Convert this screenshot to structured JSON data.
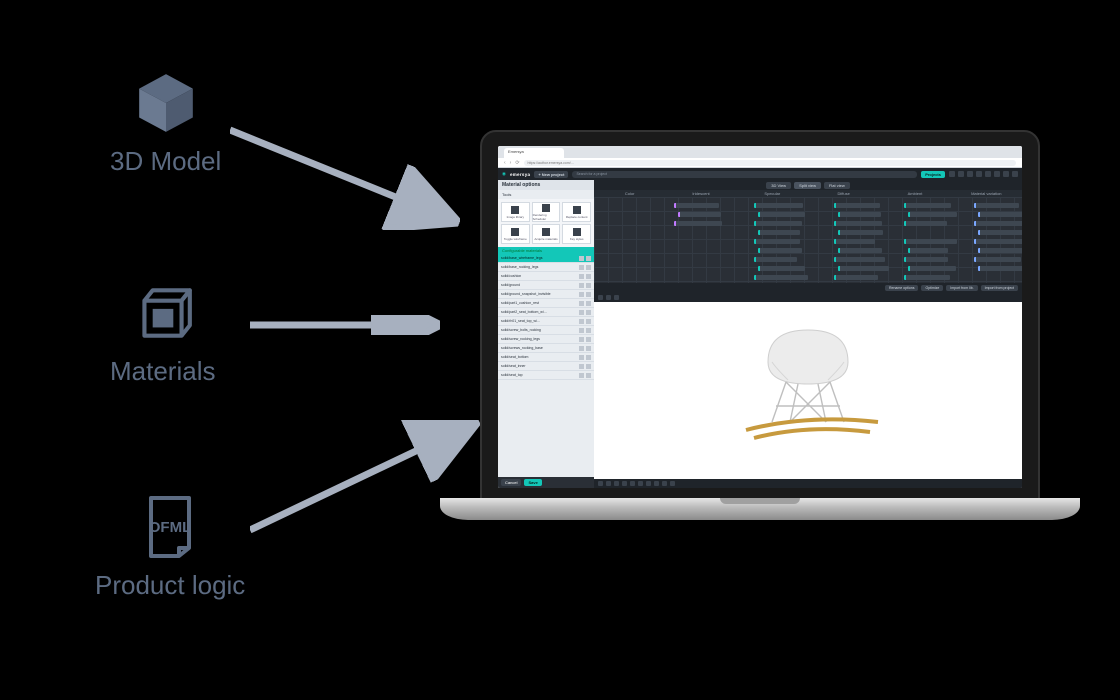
{
  "inputs": {
    "model": {
      "label": "3D Model"
    },
    "materials": {
      "label": "Materials"
    },
    "logic": {
      "label": "Product logic",
      "badge": "OFML"
    }
  },
  "browser": {
    "tab_title": "Emersya",
    "url": "https://author.emersya.com/…"
  },
  "app": {
    "brand": "emersya",
    "new_project": "+ New project",
    "search_placeholder": "Search for a project",
    "projects_btn": "Projects"
  },
  "panel": {
    "title": "Material options",
    "tools_label": "Tools",
    "tools": [
      "Image library",
      "Rendering Scheduler",
      "Replace content",
      "Toggle wireframe",
      "Acquire materials",
      "Key styles"
    ],
    "subheader": "Configurable materials",
    "active_material": "solid/base_wireframe_legs",
    "materials": [
      "solid/base_rocking_legs",
      "solid/cushion",
      "solid/ground",
      "solid/ground_snapshot_invisible",
      "solid/part1_cushion_rest",
      "solid/part2_seat_bottom_wi…",
      "solid/rh01_seat_top_wi…",
      "solid/screw_bolts_rocking",
      "solid/screw_rocking_legs",
      "solid/screws_rocking_base",
      "solid/seat_bottom",
      "solid/seat_inner",
      "solid/seat_top"
    ],
    "cancel": "Cancel",
    "save": "Save"
  },
  "view_tabs": [
    "3D View",
    "Split view",
    "Flat view"
  ],
  "graph_columns": [
    "Color",
    "Iridescent",
    "Specular",
    "Diffuse",
    "Ambient",
    "Material variation"
  ],
  "graph_actions": [
    "Rename options",
    "Optimize",
    "Import from lib.",
    "Import from project"
  ]
}
